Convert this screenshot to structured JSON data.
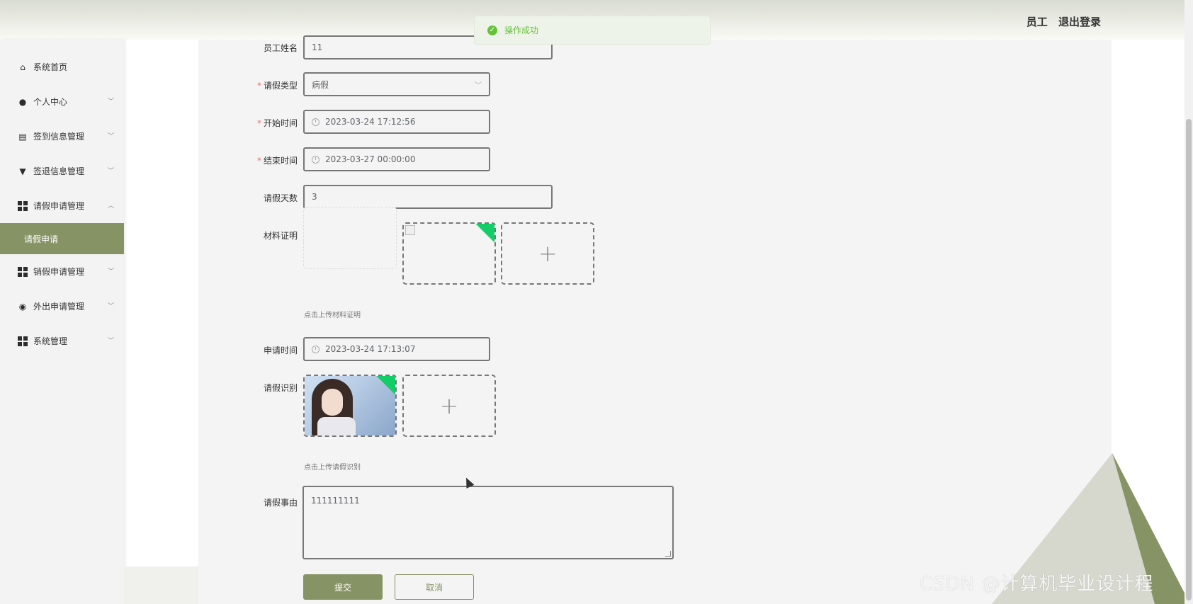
{
  "header": {
    "role": "员工",
    "logout": "退出登录"
  },
  "toast": {
    "message": "操作成功"
  },
  "sidebar": {
    "items": [
      {
        "label": "系统首页",
        "icon": "home-icon"
      },
      {
        "label": "个人中心",
        "icon": "user-icon"
      },
      {
        "label": "签到信息管理",
        "icon": "clipboard-icon"
      },
      {
        "label": "签退信息管理",
        "icon": "stamp-icon"
      },
      {
        "label": "请假申请管理",
        "icon": "grid-icon",
        "expanded": true
      },
      {
        "label": "销假申请管理",
        "icon": "grid-icon"
      },
      {
        "label": "外出申请管理",
        "icon": "location-icon"
      },
      {
        "label": "系统管理",
        "icon": "grid-icon"
      }
    ],
    "active_sub": "请假申请"
  },
  "form": {
    "name_label": "员工姓名",
    "name_value": "11",
    "type_label": "请假类型",
    "type_value": "病假",
    "start_label": "开始时间",
    "start_value": "2023-03-24 17:12:56",
    "end_label": "结束时间",
    "end_value": "2023-03-27 00:00:00",
    "days_label": "请假天数",
    "days_value": "3",
    "material_label": "材料证明",
    "material_tip": "点击上传材料证明",
    "apply_time_label": "申请时间",
    "apply_time_value": "2023-03-24 17:13:07",
    "identify_label": "请假识别",
    "identify_tip": "点击上传请假识别",
    "reason_label": "请假事由",
    "reason_value": "111111111",
    "submit": "提交",
    "cancel": "取消"
  },
  "watermark": "CSDN @计算机毕业设计程"
}
